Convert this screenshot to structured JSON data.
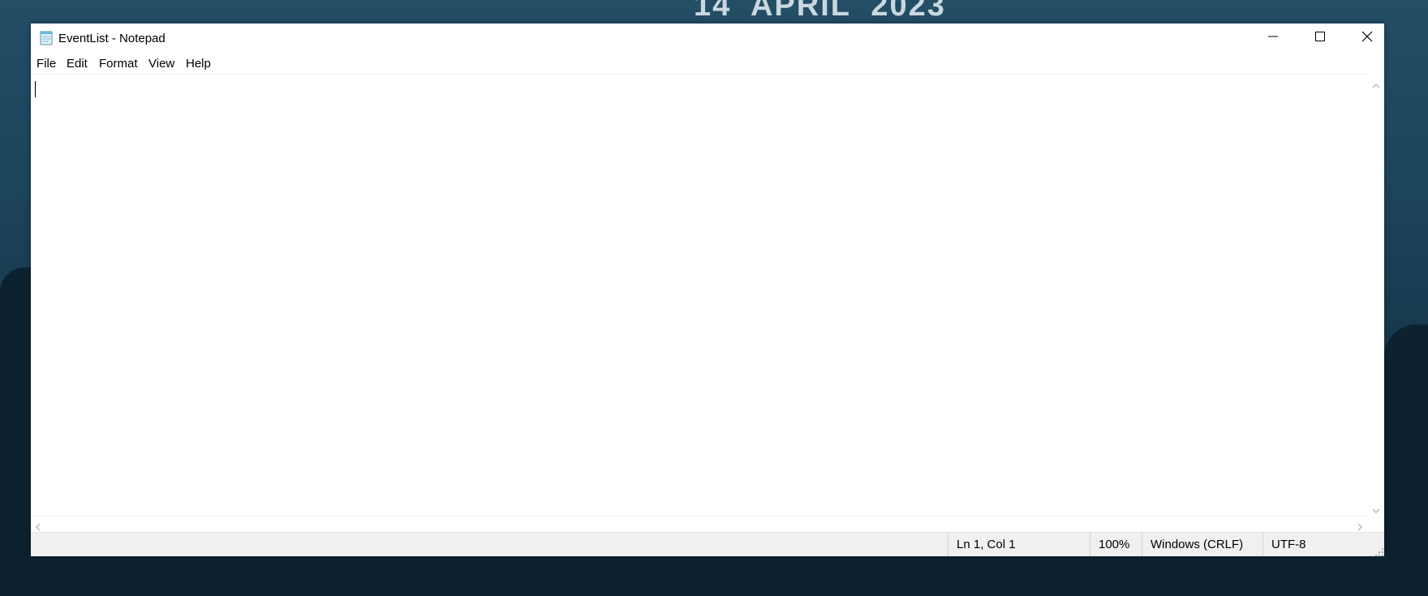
{
  "desktop": {
    "wallpaper_text": "14  APRIL  2023"
  },
  "window": {
    "title": "EventList - Notepad",
    "app_icon": "notepad-icon",
    "controls": {
      "minimize": "minimize-icon",
      "maximize": "maximize-icon",
      "close": "close-icon"
    }
  },
  "menu": {
    "items": [
      {
        "label": "File"
      },
      {
        "label": "Edit"
      },
      {
        "label": "Format"
      },
      {
        "label": "View"
      },
      {
        "label": "Help"
      }
    ]
  },
  "editor": {
    "content": ""
  },
  "status": {
    "position": "Ln 1, Col 1",
    "zoom": "100%",
    "line_ending": "Windows (CRLF)",
    "encoding": "UTF-8"
  }
}
